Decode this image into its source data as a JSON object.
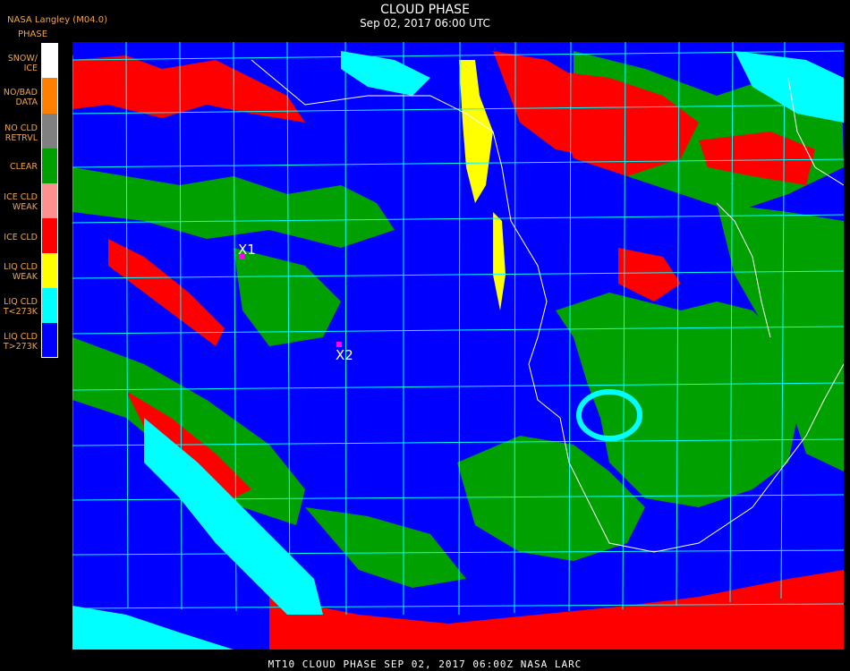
{
  "header": {
    "source": "NASA Langley (M04.0)",
    "title": "CLOUD PHASE",
    "subtitle": "Sep 02, 2017 06:00 UTC"
  },
  "legend": {
    "title": "PHASE",
    "items": [
      {
        "label": "SNOW/\nICE",
        "color": "#ffffff"
      },
      {
        "label": "NO/BAD\nDATA",
        "color": "#ff8000"
      },
      {
        "label": "NO CLD\nRETRVL",
        "color": "#808080"
      },
      {
        "label": "CLEAR",
        "color": "#00a000"
      },
      {
        "label": "ICE CLD\nWEAK",
        "color": "#ff9090"
      },
      {
        "label": "ICE CLD",
        "color": "#ff0000"
      },
      {
        "label": "LIQ CLD\nWEAK",
        "color": "#ffff00"
      },
      {
        "label": "LIQ CLD\nT<273K",
        "color": "#00ffff"
      },
      {
        "label": "LIQ CLD\nT>273K",
        "color": "#0000ff"
      }
    ]
  },
  "markers": [
    {
      "label": "X1",
      "color": "#ff00ff"
    },
    {
      "label": "X2",
      "color": "#ff00ff"
    }
  ],
  "footer": {
    "text": "MT10  CLOUD PHASE  SEP 02, 2017 06:00Z  NASA LARC"
  },
  "colors": {
    "background": "#000000",
    "grid": "#00ffff",
    "coastline": "#ffffff",
    "header_text": "#f0a64a"
  }
}
